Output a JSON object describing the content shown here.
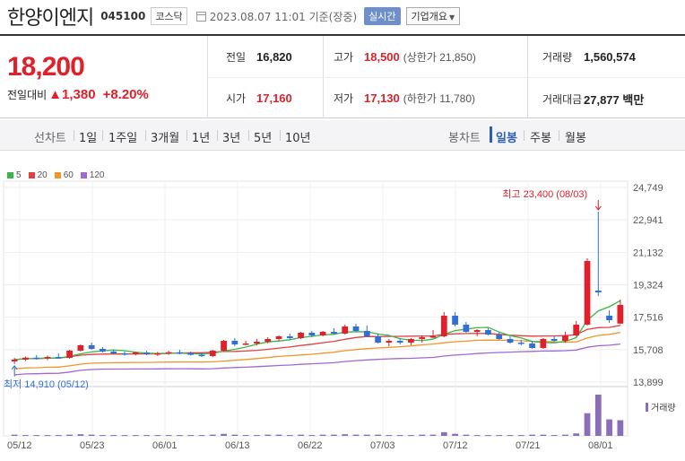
{
  "header": {
    "name": "한양이엔지",
    "code": "045100",
    "market": "코스닥",
    "datetime": "2023.08.07 11:01 기준(장중)",
    "live_label": "실시간",
    "corp_label": "기업개요"
  },
  "quote": {
    "price": "18,200",
    "change_label": "전일대비",
    "change": "▲1,380",
    "change_pct": "+8.20%",
    "prev_close_label": "전일",
    "prev_close": "16,820",
    "open_label": "시가",
    "open": "17,160",
    "high_label": "고가",
    "high": "18,500",
    "upper_limit": "(상한가 21,850)",
    "low_label": "저가",
    "low": "17,130",
    "lower_limit": "(하한가 11,780)",
    "volume_label": "거래량",
    "volume": "1,560,574",
    "amount_label": "거래대금",
    "amount": "27,877 백만"
  },
  "tabs": {
    "line_chart": "선차트",
    "periods": [
      "1일",
      "1주일",
      "3개월",
      "1년",
      "3년",
      "5년",
      "10년"
    ],
    "candle_chart": "봉차트",
    "candle_periods": [
      "일봉",
      "주봉",
      "월봉"
    ]
  },
  "legend": [
    {
      "label": "5",
      "color": "#3cb54a"
    },
    {
      "label": "20",
      "color": "#e04040"
    },
    {
      "label": "60",
      "color": "#f0962a"
    },
    {
      "label": "120",
      "color": "#a068d0"
    }
  ],
  "colors": {
    "up": "#e0202a",
    "down": "#2f6fd6"
  },
  "chart_data": {
    "type": "candlestick",
    "y_ticks": [
      "24,749",
      "22,941",
      "21,132",
      "19,324",
      "17,516",
      "15,708",
      "13,899"
    ],
    "ylim": [
      13899,
      24749
    ],
    "x_ticks": [
      "05/12",
      "05/23",
      "06/01",
      "06/13",
      "06/22",
      "07/03",
      "07/12",
      "07/21",
      "08/01"
    ],
    "high_annotation": "최고 23,400 (08/03)",
    "low_annotation": "최저 14,910 (05/12)",
    "volume_label": "거래량",
    "candles": [
      {
        "o": 15050,
        "h": 15250,
        "l": 14910,
        "c": 15150
      },
      {
        "o": 15150,
        "h": 15320,
        "l": 15080,
        "c": 15260
      },
      {
        "o": 15260,
        "h": 15400,
        "l": 15150,
        "c": 15220
      },
      {
        "o": 15220,
        "h": 15380,
        "l": 15120,
        "c": 15300
      },
      {
        "o": 15300,
        "h": 15500,
        "l": 15200,
        "c": 15250
      },
      {
        "o": 15250,
        "h": 15700,
        "l": 15200,
        "c": 15650
      },
      {
        "o": 15650,
        "h": 16000,
        "l": 15600,
        "c": 15950
      },
      {
        "o": 15950,
        "h": 16100,
        "l": 15700,
        "c": 15750
      },
      {
        "o": 15750,
        "h": 15850,
        "l": 15550,
        "c": 15600
      },
      {
        "o": 15600,
        "h": 15700,
        "l": 15450,
        "c": 15500
      },
      {
        "o": 15500,
        "h": 15600,
        "l": 15380,
        "c": 15450
      },
      {
        "o": 15450,
        "h": 15600,
        "l": 15380,
        "c": 15550
      },
      {
        "o": 15550,
        "h": 15650,
        "l": 15400,
        "c": 15450
      },
      {
        "o": 15450,
        "h": 15580,
        "l": 15350,
        "c": 15500
      },
      {
        "o": 15500,
        "h": 15650,
        "l": 15420,
        "c": 15560
      },
      {
        "o": 15560,
        "h": 15700,
        "l": 15450,
        "c": 15520
      },
      {
        "o": 15520,
        "h": 15600,
        "l": 15380,
        "c": 15420
      },
      {
        "o": 15420,
        "h": 15550,
        "l": 15300,
        "c": 15350
      },
      {
        "o": 15350,
        "h": 15700,
        "l": 15300,
        "c": 15650
      },
      {
        "o": 15650,
        "h": 16250,
        "l": 15600,
        "c": 16200
      },
      {
        "o": 16200,
        "h": 16350,
        "l": 15900,
        "c": 16000
      },
      {
        "o": 16000,
        "h": 16200,
        "l": 15950,
        "c": 16050
      },
      {
        "o": 16050,
        "h": 16300,
        "l": 15950,
        "c": 16150
      },
      {
        "o": 16150,
        "h": 16400,
        "l": 16050,
        "c": 16300
      },
      {
        "o": 16300,
        "h": 16500,
        "l": 16200,
        "c": 16450
      },
      {
        "o": 16450,
        "h": 16600,
        "l": 16250,
        "c": 16350
      },
      {
        "o": 16350,
        "h": 16700,
        "l": 16300,
        "c": 16650
      },
      {
        "o": 16650,
        "h": 16750,
        "l": 16400,
        "c": 16500
      },
      {
        "o": 16500,
        "h": 16750,
        "l": 16450,
        "c": 16700
      },
      {
        "o": 16700,
        "h": 16900,
        "l": 16550,
        "c": 16600
      },
      {
        "o": 16600,
        "h": 17100,
        "l": 16550,
        "c": 17000
      },
      {
        "o": 17000,
        "h": 17150,
        "l": 16700,
        "c": 16750
      },
      {
        "o": 16750,
        "h": 17050,
        "l": 16400,
        "c": 16450
      },
      {
        "o": 16450,
        "h": 16600,
        "l": 16050,
        "c": 16100
      },
      {
        "o": 16100,
        "h": 16300,
        "l": 15900,
        "c": 16200
      },
      {
        "o": 16200,
        "h": 16350,
        "l": 16000,
        "c": 16100
      },
      {
        "o": 16100,
        "h": 16350,
        "l": 15950,
        "c": 16300
      },
      {
        "o": 16300,
        "h": 16500,
        "l": 16100,
        "c": 16400
      },
      {
        "o": 16400,
        "h": 16800,
        "l": 16350,
        "c": 16450
      },
      {
        "o": 16450,
        "h": 17800,
        "l": 16400,
        "c": 17600
      },
      {
        "o": 17600,
        "h": 17800,
        "l": 17000,
        "c": 17100
      },
      {
        "o": 17100,
        "h": 17250,
        "l": 16650,
        "c": 16700
      },
      {
        "o": 16700,
        "h": 16850,
        "l": 16450,
        "c": 16800
      },
      {
        "o": 16800,
        "h": 16900,
        "l": 16500,
        "c": 16550
      },
      {
        "o": 16550,
        "h": 16700,
        "l": 16250,
        "c": 16300
      },
      {
        "o": 16300,
        "h": 16450,
        "l": 16050,
        "c": 16100
      },
      {
        "o": 16100,
        "h": 16250,
        "l": 15950,
        "c": 16050
      },
      {
        "o": 16050,
        "h": 16200,
        "l": 15750,
        "c": 15800
      },
      {
        "o": 15800,
        "h": 16350,
        "l": 15750,
        "c": 16300
      },
      {
        "o": 16300,
        "h": 16500,
        "l": 16150,
        "c": 16200
      },
      {
        "o": 16200,
        "h": 16700,
        "l": 16100,
        "c": 16500
      },
      {
        "o": 16500,
        "h": 17300,
        "l": 16450,
        "c": 17100
      },
      {
        "o": 17100,
        "h": 20800,
        "l": 17050,
        "c": 20650
      },
      {
        "o": 19000,
        "h": 23400,
        "l": 18700,
        "c": 18900
      },
      {
        "o": 17600,
        "h": 17900,
        "l": 17200,
        "c": 17350
      },
      {
        "o": 17160,
        "h": 18500,
        "l": 17130,
        "c": 18200
      }
    ],
    "volumes": [
      3,
      2,
      2,
      2,
      2,
      3,
      4,
      3,
      2,
      2,
      2,
      2,
      2,
      2,
      2,
      2,
      2,
      2,
      3,
      5,
      3,
      2,
      2,
      3,
      3,
      2,
      3,
      2,
      3,
      3,
      4,
      3,
      3,
      3,
      2,
      2,
      2,
      3,
      3,
      9,
      5,
      3,
      2,
      2,
      2,
      2,
      2,
      3,
      3,
      2,
      3,
      6,
      55,
      100,
      40,
      38
    ]
  }
}
